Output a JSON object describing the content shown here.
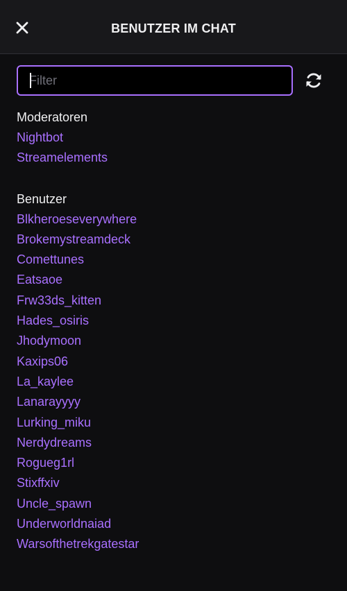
{
  "header": {
    "title": "BENUTZER IM CHAT",
    "close_icon": "close-icon"
  },
  "filter": {
    "placeholder": "Filter",
    "value": ""
  },
  "refresh_icon": "refresh-icon",
  "moderators": {
    "heading": "Moderatoren",
    "users": [
      "Nightbot",
      "Streamelements"
    ]
  },
  "users": {
    "heading": "Benutzer",
    "users": [
      "Blkheroeseverywhere",
      "Brokemystreamdeck",
      "Comettunes",
      "Eatsaoe",
      "Frw33ds_kitten",
      "Hades_osiris",
      "Jhodymoon",
      "Kaxips06",
      "La_kaylee",
      "Lanarayyyy",
      "Lurking_miku",
      "Nerdydreams",
      "Rogueg1rl",
      "Stixffxiv",
      "Uncle_spawn",
      "Underworldnaiad",
      "Warsofthetrekgatestar"
    ]
  },
  "colors": {
    "background": "#0e0e10",
    "header_background": "#18181b",
    "accent": "#a970ff",
    "text": "#efeff1"
  }
}
